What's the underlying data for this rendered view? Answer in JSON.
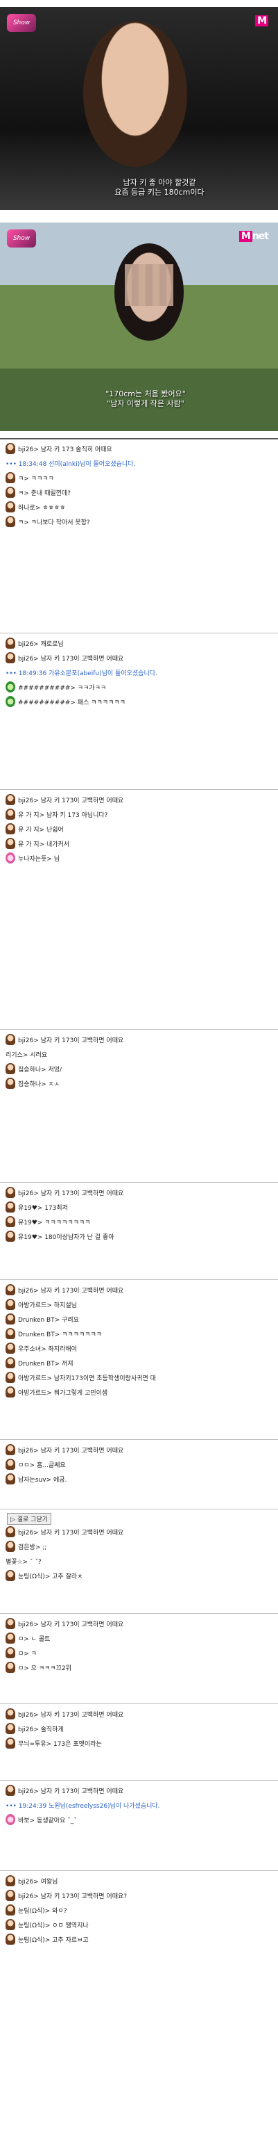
{
  "screenshot1": {
    "logo_text": "Show",
    "channel": "M",
    "caption_line1": "남자 키 좋 아야 할것같",
    "caption_line2": "요즘 등급 키는 180cm이다"
  },
  "screenshot2": {
    "logo_text": "Show",
    "channel_m": "M",
    "channel_rest": "net",
    "caption_line1": "\"170cm는 처음 봤어요\"",
    "caption_line2": "\"남자 이렇게 작은 사람\""
  },
  "chat": {
    "blocks": [
      {
        "rows": [
          {
            "type": "msg",
            "avatar": "brown",
            "text": "bji26> 남자 키 173 솔직히 어때요"
          },
          {
            "type": "sys",
            "text": "••• 18:34:48  선미(alnki)님이 들어오셨습니다."
          },
          {
            "type": "msg",
            "avatar": "brown",
            "text": "ㅋ> ㅋㅋㅋㅋ"
          },
          {
            "type": "msg",
            "avatar": "brown",
            "text": "ㅋ> 준내 때릴껀데?"
          },
          {
            "type": "msg",
            "avatar": "brown",
            "text": "하나로> ㅎㅎㅎㅎ"
          },
          {
            "type": "msg",
            "avatar": "brown",
            "text": "ㅋ> ㅋ나보다 작아서 못함?"
          }
        ]
      },
      {
        "rows": [
          {
            "type": "msg",
            "avatar": "brown",
            "text": "bji26> 캐로로님"
          },
          {
            "type": "msg",
            "avatar": "brown",
            "text": "bji26> 남자 키 173이 고백하면 어때요"
          },
          {
            "type": "sys",
            "text": "••• 18:49:36  가유소분포(abeifu)님이 들어오셨습니다."
          },
          {
            "type": "msg",
            "avatar": "green",
            "text": "##########> ㅋㅋ가ㅋㅋ"
          },
          {
            "type": "msg",
            "avatar": "green",
            "text": "##########> 패스 ㅋㅋㅋㅋㅋㅋ"
          }
        ]
      },
      {
        "rows": [
          {
            "type": "msg",
            "avatar": "brown",
            "text": "bji26> 남자 키 173이 고백하면 어때요"
          },
          {
            "type": "msg",
            "avatar": "brown",
            "text": "유  가  지> 남자 키 173 아닙니다?"
          },
          {
            "type": "msg",
            "avatar": "brown",
            "text": "유  가  지> 난쉽어"
          },
          {
            "type": "msg",
            "avatar": "brown",
            "text": "유  가  지> 내가커서"
          },
          {
            "type": "msg",
            "avatar": "pink",
            "text": "누나자는듯>            님"
          }
        ]
      },
      {
        "rows": [
          {
            "type": "msg",
            "avatar": "brown",
            "text": "bji26> 남자 키 173이 고백하면 어때요"
          },
          {
            "type": "msg",
            "avatar": "none",
            "text": "     리기스> 시러요"
          },
          {
            "type": "msg",
            "avatar": "brown",
            "text": "집승하나> 저엉/"
          },
          {
            "type": "msg",
            "avatar": "brown",
            "text": "집승하나> ㅈㅅ"
          }
        ]
      },
      {
        "rows": [
          {
            "type": "msg",
            "avatar": "brown",
            "text": "bji26> 남자 키 173이 고백하면 어때요"
          },
          {
            "type": "msg",
            "avatar": "brown",
            "text": "유19♥> 173최저"
          },
          {
            "type": "msg",
            "avatar": "brown",
            "text": "유19♥> ㅋㅋㅋㅋㅋㅋㅋㅋ"
          },
          {
            "type": "msg",
            "avatar": "brown",
            "text": "유19♥> 180이상남자가 난 걸 좋아"
          }
        ]
      },
      {
        "rows": [
          {
            "type": "msg",
            "avatar": "brown",
            "text": "bji26> 남자 키 173이 고백하면 어때요"
          },
          {
            "type": "msg",
            "avatar": "brown",
            "text": "아방가르드> 하지설님"
          },
          {
            "type": "msg",
            "avatar": "brown",
            "text": "Drunken BT> 구려요"
          },
          {
            "type": "msg",
            "avatar": "brown",
            "text": "Drunken BT> ㅋㅋㅋㅋㅋㅋㅋ"
          },
          {
            "type": "msg",
            "avatar": "brown",
            "text": "우주소녀> 좌지라해여"
          },
          {
            "type": "msg",
            "avatar": "brown",
            "text": "Drunken BT> 꺼져"
          },
          {
            "type": "msg",
            "avatar": "brown",
            "text": "아방가르드> 남자키173이면 초등학생이랑사귀면 대"
          },
          {
            "type": "msg",
            "avatar": "brown",
            "text": "아방가르드> 뭐가그렇게 고민이셈"
          }
        ]
      },
      {
        "rows": [
          {
            "type": "msg",
            "avatar": "brown",
            "text": "bji26> 남자 키 173이 고백하면 어때요"
          },
          {
            "type": "msg",
            "avatar": "brown",
            "text": "ㅁㅁ> 흠...글쎄요"
          },
          {
            "type": "msg",
            "avatar": "brown",
            "text": "남자는suv> 에궁."
          }
        ]
      },
      {
        "close_button": "▷ 결로 그닫기",
        "rows": [
          {
            "type": "msg",
            "avatar": "brown",
            "text": "bji26> 남자 키 173이 고백하면 어때요"
          },
          {
            "type": "msg",
            "avatar": "brown",
            "text": "검은방> ;;"
          },
          {
            "type": "msg",
            "avatar": "none",
            "text": "   별꽃☆> ˇ ˇ?"
          },
          {
            "type": "msg",
            "avatar": "brown",
            "text": "눈팅(Ω식)> 고추 잘라ㅊ"
          }
        ]
      },
      {
        "rows": [
          {
            "type": "msg",
            "avatar": "brown",
            "text": "bji26> 남자 키 173이 고백하면 어때요"
          },
          {
            "type": "msg",
            "avatar": "brown",
            "text": "ㅁ> ㄴ 콜트"
          },
          {
            "type": "msg",
            "avatar": "brown",
            "text": "ㅁ> ㅋ"
          },
          {
            "type": "msg",
            "avatar": "brown",
            "text": "ㅁ> 으 ㅋㅋㅋ끄2위"
          }
        ]
      },
      {
        "rows": [
          {
            "type": "msg",
            "avatar": "brown",
            "text": "bji26> 남자 키 173이 고백하면 어때요"
          },
          {
            "type": "msg",
            "avatar": "brown",
            "text": "bji26> 솔직하게"
          },
          {
            "type": "msg",
            "avatar": "brown",
            "text": "무늬∞투유> 173은 포맷이라는"
          }
        ]
      },
      {
        "rows": [
          {
            "type": "msg",
            "avatar": "brown",
            "text": "bji26> 남자 키 173이 고백하면 어때요"
          },
          {
            "type": "sys",
            "text": "••• 19:24:39  노원님(esfreelyss26)님이 나가셨습니다."
          },
          {
            "type": "msg",
            "avatar": "pink",
            "text": "바보> 동생같아요 ˇ_ˇ"
          }
        ]
      },
      {
        "rows": [
          {
            "type": "msg",
            "avatar": "brown",
            "text": "bji26> 여왕님"
          },
          {
            "type": "msg",
            "avatar": "brown",
            "text": "bji26> 남자 키 173이 고백하면 어때요?"
          },
          {
            "type": "msg",
            "avatar": "brown",
            "text": "눈팅(Ω식)> 와ㅇ?"
          },
          {
            "type": "msg",
            "avatar": "brown",
            "text": "눈팅(Ω식)> ㅇㅁ 땡역지나"
          },
          {
            "type": "msg",
            "avatar": "brown",
            "text": "눈팅(Ω식)> 고추 자르ㅂ고"
          }
        ]
      }
    ]
  }
}
